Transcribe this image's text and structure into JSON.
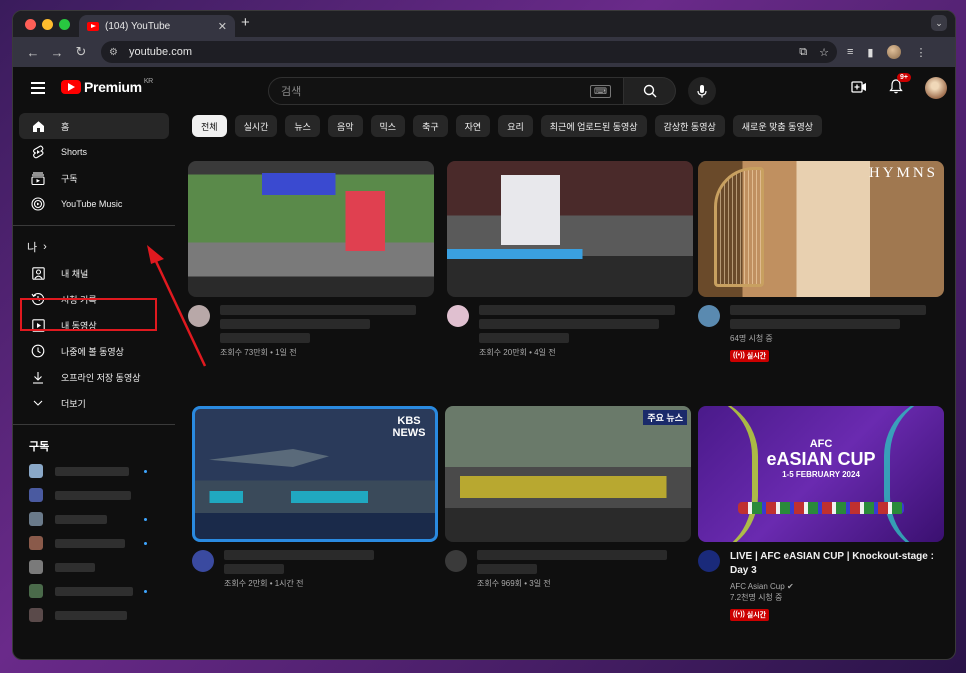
{
  "browser": {
    "tab_title": "(104) YouTube",
    "tab_close": "✕",
    "new_tab": "+",
    "tab_menu": "⌄",
    "url": "youtube.com"
  },
  "header": {
    "logo_text": "Premium",
    "logo_region": "KR",
    "search_placeholder": "검색",
    "notification_count": "9+"
  },
  "sidebar": {
    "main": [
      {
        "label": "홈",
        "icon": "home-icon"
      },
      {
        "label": "Shorts",
        "icon": "shorts-icon"
      },
      {
        "label": "구독",
        "icon": "subscriptions-icon"
      },
      {
        "label": "YouTube Music",
        "icon": "youtube-music-icon"
      }
    ],
    "you_header": "나",
    "you": [
      {
        "label": "내 채널",
        "icon": "channel-icon"
      },
      {
        "label": "시청 기록",
        "icon": "history-icon"
      },
      {
        "label": "내 동영상",
        "icon": "my-videos-icon"
      },
      {
        "label": "나중에 볼 동영상",
        "icon": "watch-later-icon"
      },
      {
        "label": "오프라인 저장 동영상",
        "icon": "download-icon"
      },
      {
        "label": "더보기",
        "icon": "chevron-down-icon"
      }
    ],
    "subs_header": "구독"
  },
  "chips": [
    "전체",
    "실시간",
    "뉴스",
    "음악",
    "믹스",
    "축구",
    "자연",
    "요리",
    "최근에 업로드된 동영상",
    "감상한 동영상",
    "새로운 맞춤 동영상"
  ],
  "videos": [
    {
      "stats": "조회수 73만회 • 1일 전"
    },
    {
      "stats": "조회수 20만회 • 4일 전"
    },
    {
      "stats": "64명 시청 중",
      "live": "실시간",
      "thumb_text": "HYMNS"
    },
    {
      "stats": "조회수 2만회 • 1시간 전",
      "thumb_text": "KBS NEWS"
    },
    {
      "stats": "조회수 969회 • 3일 전",
      "thumb_text": "주요 뉴스"
    },
    {
      "title": "LIVE | AFC eASIAN CUP | Knockout-stage : Day 3",
      "channel": "AFC Asian Cup",
      "stats": "7.2천명 시청 중",
      "live": "실시간",
      "thumb_line1": "AFC",
      "thumb_line2": "eASIAN CUP",
      "thumb_line3": "1-5 FEBRUARY 2024"
    }
  ],
  "colors": {
    "accent_red": "#e0191f",
    "live_red": "#cc0000",
    "link_blue": "#3ea6ff"
  }
}
